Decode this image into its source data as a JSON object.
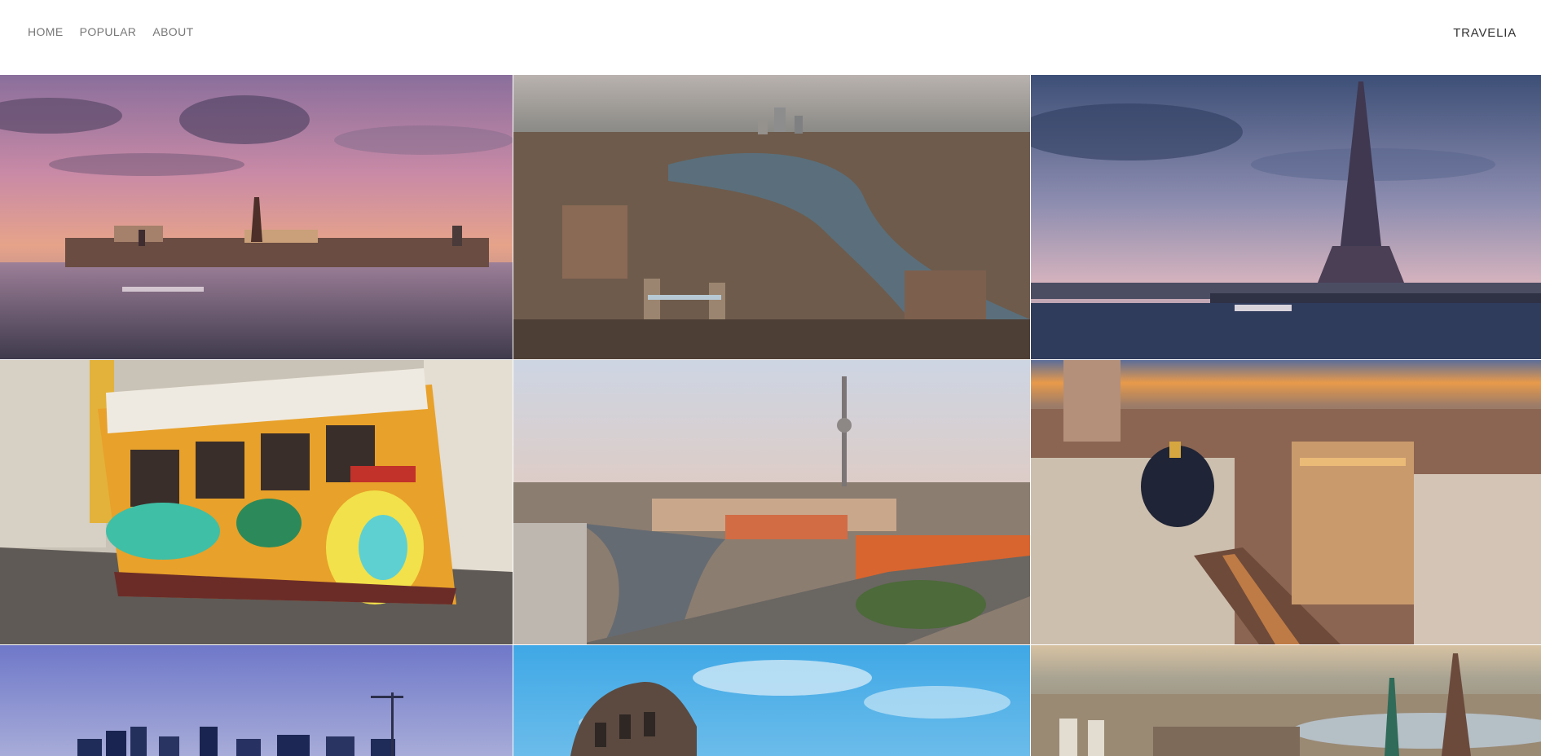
{
  "nav": {
    "items": [
      {
        "label": "HOME"
      },
      {
        "label": "POPULAR"
      },
      {
        "label": "ABOUT"
      }
    ]
  },
  "brand": {
    "label": "TRAVELIA"
  },
  "gallery": {
    "tiles": [
      {
        "icon": "stockholm-photo"
      },
      {
        "icon": "london-photo"
      },
      {
        "icon": "paris-photo"
      },
      {
        "icon": "lisbon-tram-photo"
      },
      {
        "icon": "berlin-photo"
      },
      {
        "icon": "madrid-photo"
      },
      {
        "icon": "oslo-photo"
      },
      {
        "icon": "rome-photo"
      },
      {
        "icon": "zurich-photo"
      }
    ]
  }
}
